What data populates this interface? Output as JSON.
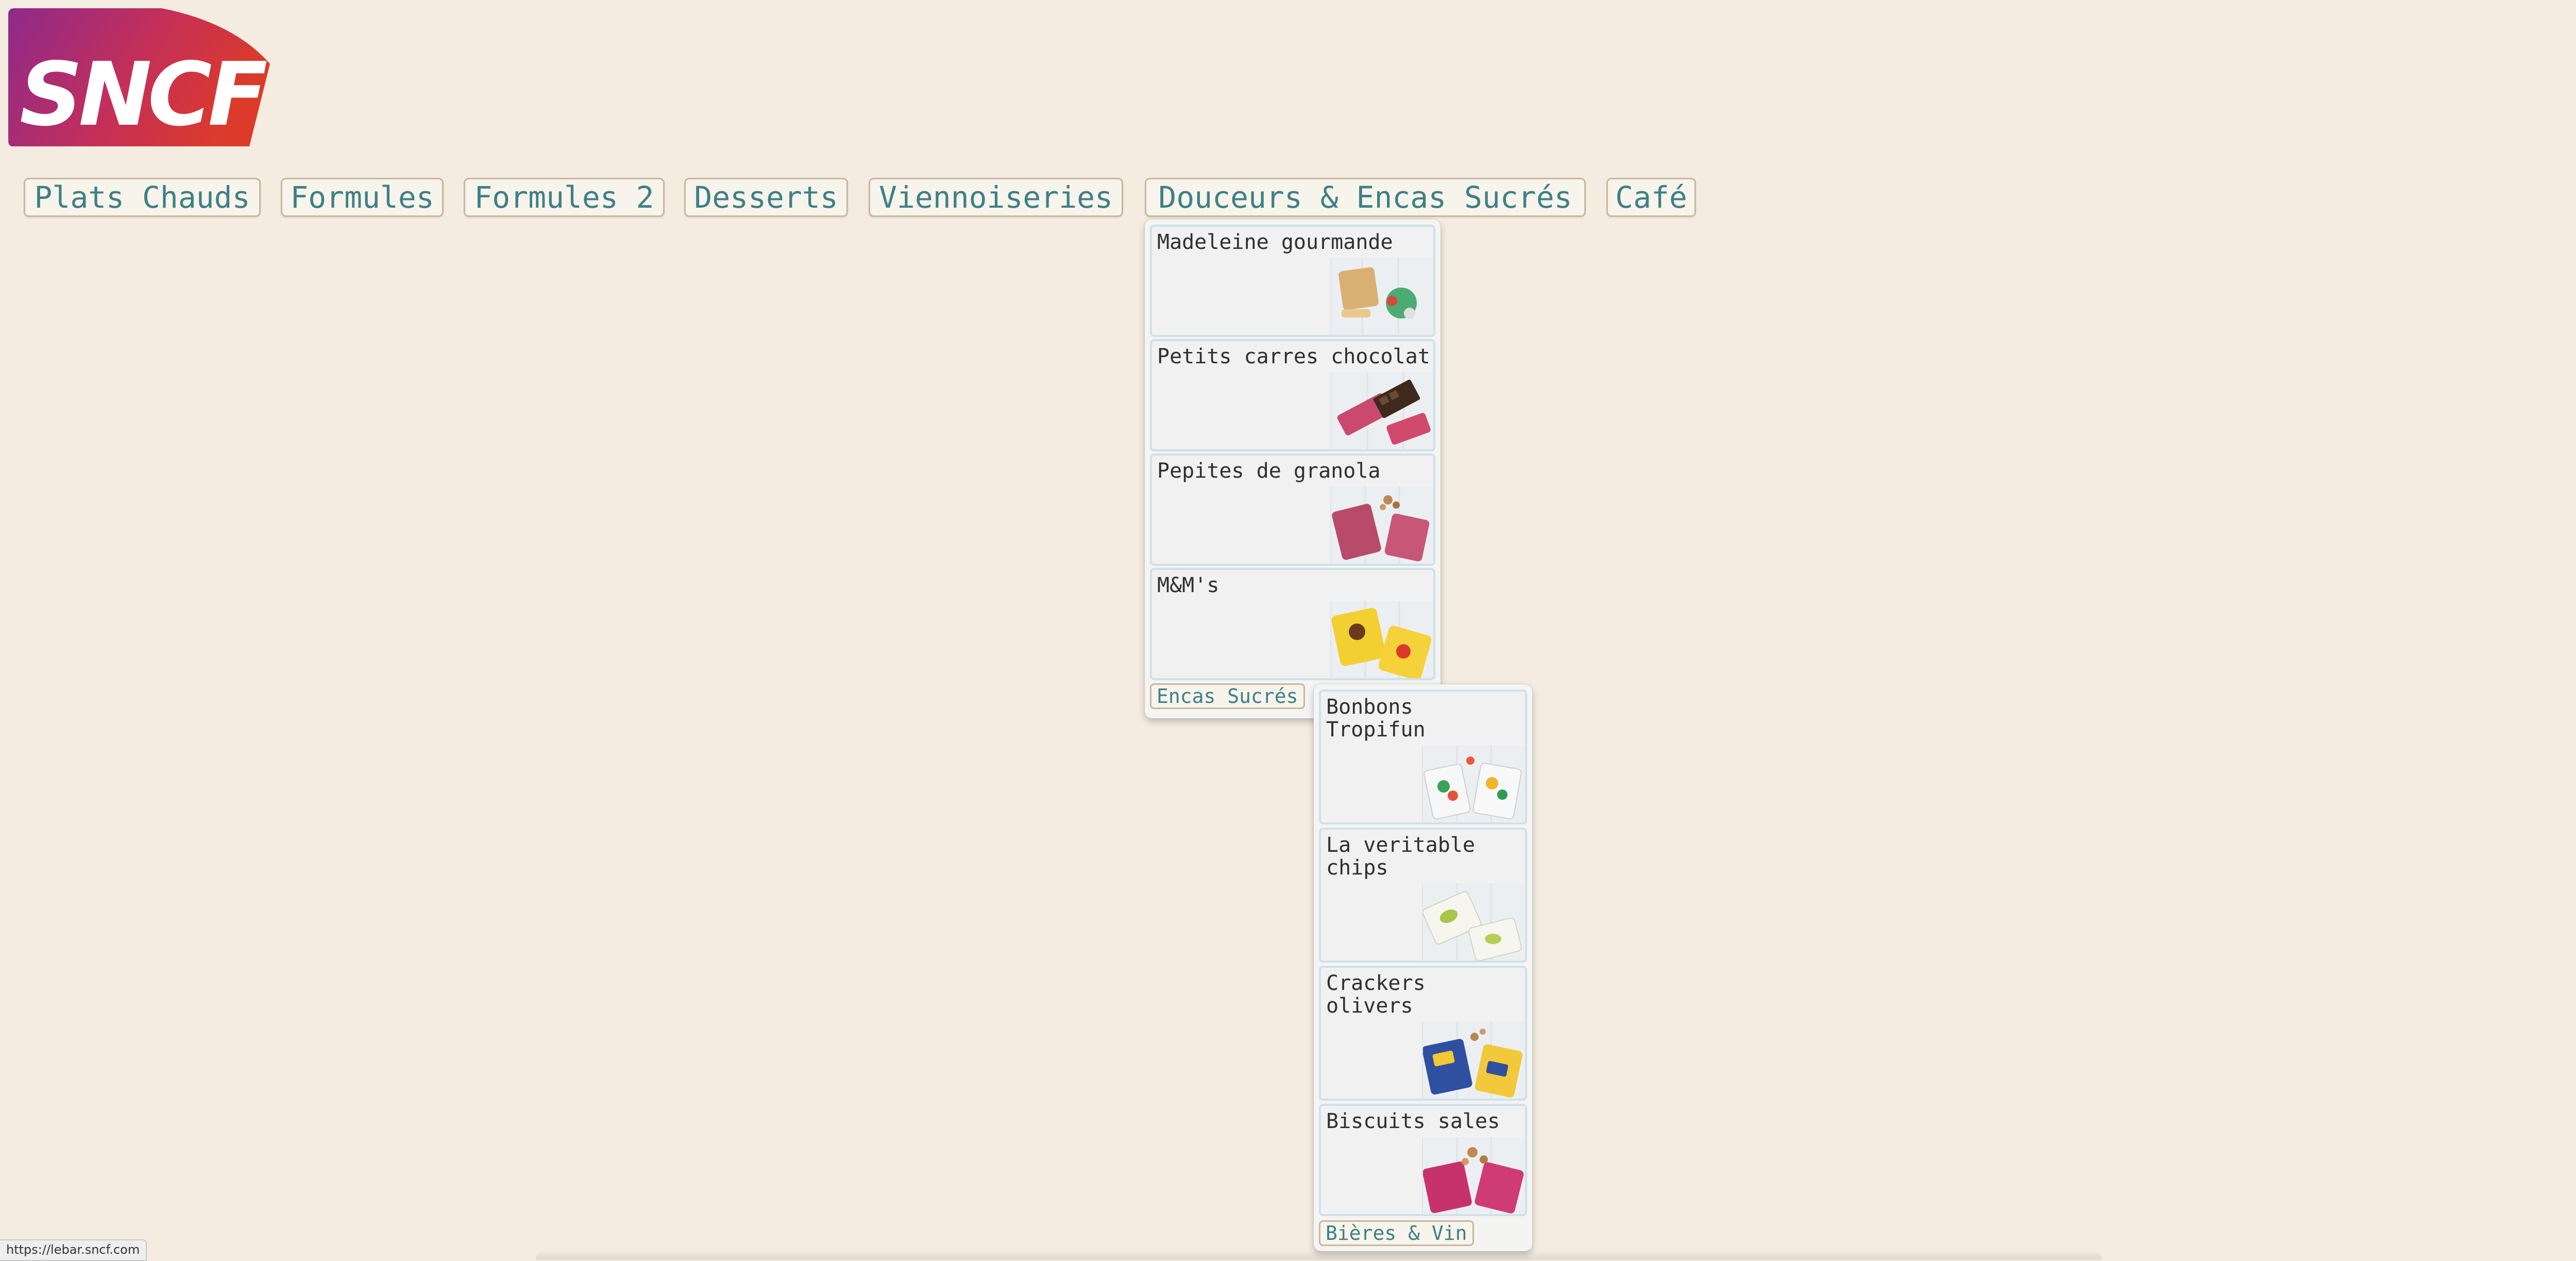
{
  "brand": {
    "logo_text": "SNCF",
    "gradient_start": "#8e2a8b",
    "gradient_end": "#dc3a2a"
  },
  "nav": {
    "items": [
      {
        "label": "Plats Chauds"
      },
      {
        "label": "Formules"
      },
      {
        "label": "Formules 2"
      },
      {
        "label": "Desserts"
      },
      {
        "label": "Viennoiseries"
      },
      {
        "label": "Douceurs & Encas Sucrés"
      },
      {
        "label": "Café"
      }
    ]
  },
  "dropdown_douceurs": {
    "items": [
      {
        "title": "Madeleine gourmande",
        "icon": "madeleine-photo"
      },
      {
        "title": "Petits carres chocolat",
        "icon": "chocolate-squares-photo"
      },
      {
        "title": "Pepites de granola",
        "icon": "granola-photo"
      },
      {
        "title": "M&M's",
        "icon": "mms-photo"
      }
    ],
    "submenu_button": "Encas Sucrés"
  },
  "dropdown_encas": {
    "items": [
      {
        "title": "Bonbons\nTropifun",
        "icon": "candy-photo"
      },
      {
        "title": "La veritable\nchips",
        "icon": "chips-photo"
      },
      {
        "title": "Crackers\nolivers",
        "icon": "crackers-photo"
      },
      {
        "title": "Biscuits sales",
        "icon": "biscuits-photo"
      }
    ],
    "submenu_button": "Bières & Vin"
  },
  "status_bar": {
    "url": "https://lebar.sncf.com"
  },
  "colors": {
    "page_bg": "#f4ebe1",
    "nav_text": "#3f7f86",
    "nav_border": "#c9b79c",
    "card_border": "#cfe1e9",
    "card_bg": "#f1f1f1"
  }
}
